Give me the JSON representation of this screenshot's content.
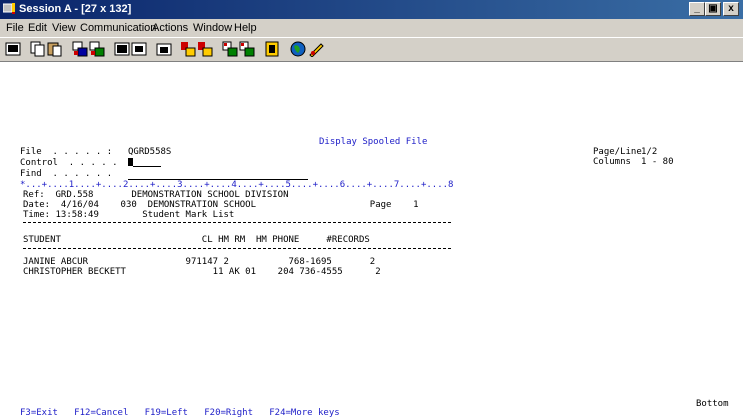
{
  "window": {
    "title": "Session A - [27 x 132]",
    "controls": [
      "_",
      "&#x25A1;",
      "x"
    ]
  },
  "menu": [
    "File",
    "Edit",
    "View",
    "Communication",
    "Actions",
    "Window",
    "Help"
  ],
  "toolbar_icons": [
    "print-screen-icon",
    "copy-icon",
    "paste-icon",
    "send-icon",
    "receive-icon",
    "display-icon",
    "display-alt-icon",
    "macro-icon",
    "record-macro-icon",
    "play-macro-icon",
    "transfer-send-icon",
    "transfer-receive-icon",
    "clipboard-icon",
    "internet-icon",
    "key-icon"
  ],
  "screen": {
    "heading": "Display Spooled File",
    "file_label": "File  . . . . . :",
    "file_value": "QGRD558S",
    "control_label": "Control  . . . . .",
    "find_label": "Find  . . . . . .",
    "pageline_label": "Page/Line",
    "pageline_value": "1/2",
    "columns_label": "Columns",
    "columns_value": "1 - 80",
    "ruler": "*...+....1....+....2....+....3....+....4....+....5....+....6....+....7....+....8",
    "report": {
      "ref": "Ref:  GRD.558       DEMONSTRATION SCHOOL DIVISION",
      "date": "Date:  4/16/04    030  DEMONSTRATION SCHOOL                     Page    1",
      "time": "Time: 13:58:49        Student Mark List",
      "header": "STUDENT                          CL HM RM  HM PHONE     #RECORDS",
      "rows": [
        "JANINE ABCUR                  971147 2           768-1695       2",
        "CHRISTOPHER BECKETT                11 AK 01    204 736-4555      2"
      ]
    },
    "fkeys": "F3=Exit   F12=Cancel   F19=Left   F20=Right   F24=More keys",
    "bottom": "Bottom"
  }
}
